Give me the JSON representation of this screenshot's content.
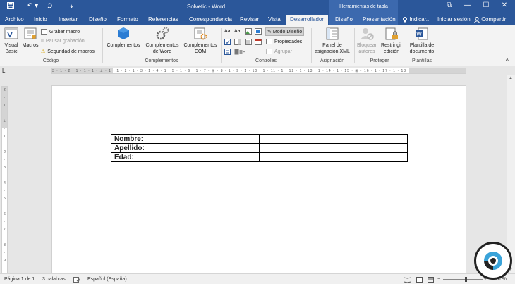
{
  "title_bar": {
    "window_title": "Solvetic - Word",
    "context_header": "Herramientas de tabla",
    "undo_label": "↶ ▾",
    "customize_label": "⇣",
    "restore_label": "⧉",
    "minimize_label": "—",
    "maximize_label": "☐",
    "close_label": "✕"
  },
  "tabs": [
    "Archivo",
    "Inicio",
    "Insertar",
    "Diseño",
    "Formato",
    "Referencias",
    "Correspondencia",
    "Revisar",
    "Vista",
    "Desarrollador",
    "Diseño",
    "Presentación"
  ],
  "tab_right": {
    "tell_me": "Indicar...",
    "signin": "Iniciar sesión",
    "share": "Compartir"
  },
  "ribbon": {
    "codigo": {
      "label": "Código",
      "visual_basic": "Visual Basic",
      "macros": "Macros",
      "grabar_macro": "Grabar macro",
      "pausar_grabacion": "Pausar grabación",
      "seguridad_macros": "Seguridad de macros"
    },
    "complementos": {
      "label": "Complementos",
      "complementos": "Complementos",
      "word": "Complementos de Word",
      "com": "Complementos COM"
    },
    "controles": {
      "label": "Controles",
      "modo_diseno": "Modo Diseño",
      "propiedades": "Propiedades",
      "agrupar": "Agrupar"
    },
    "asignacion": {
      "label": "Asignación",
      "panel": "Panel de asignación XML"
    },
    "proteger": {
      "label": "Proteger",
      "bloquear": "Bloquear autores",
      "restringir": "Restringir edición"
    },
    "plantillas": {
      "label": "Plantillas",
      "plantilla": "Plantilla de documento"
    }
  },
  "ruler": {
    "horizontal": "3 · 1 · 2 · 1 · 1 · 1 · ⊥ · 1 · 1 · 2 · 1 · 3 · 1 · 4 · 1 · 5 · 1 · 6 · 1 · 7 · ⊞ · 8 · 1 · 9 · 1 · 10 · 1 · 11 · 1 · 12 · 1 · 13 · 1 · 14 · 1 · 15 · ⊞ · 16 · 1 · 17 · 1 · 18",
    "vertical": [
      "2",
      "·",
      "1",
      "·",
      "⊥",
      "·",
      "1",
      "·",
      "2",
      "·",
      "3",
      "·",
      "4",
      "·",
      "5",
      "·",
      "6",
      "·",
      "7",
      "·",
      "8",
      "·",
      "9",
      "·",
      "10"
    ]
  },
  "document": {
    "rows": [
      {
        "label": "Nombre:",
        "value": ""
      },
      {
        "label": "Apellido:",
        "value": ""
      },
      {
        "label": "Edad:",
        "value": ""
      }
    ]
  },
  "status": {
    "page": "Página 1 de 1",
    "words": "3 palabras",
    "language": "Español (España)",
    "zoom": "120 %"
  },
  "colors": {
    "accent": "#2b579a"
  }
}
